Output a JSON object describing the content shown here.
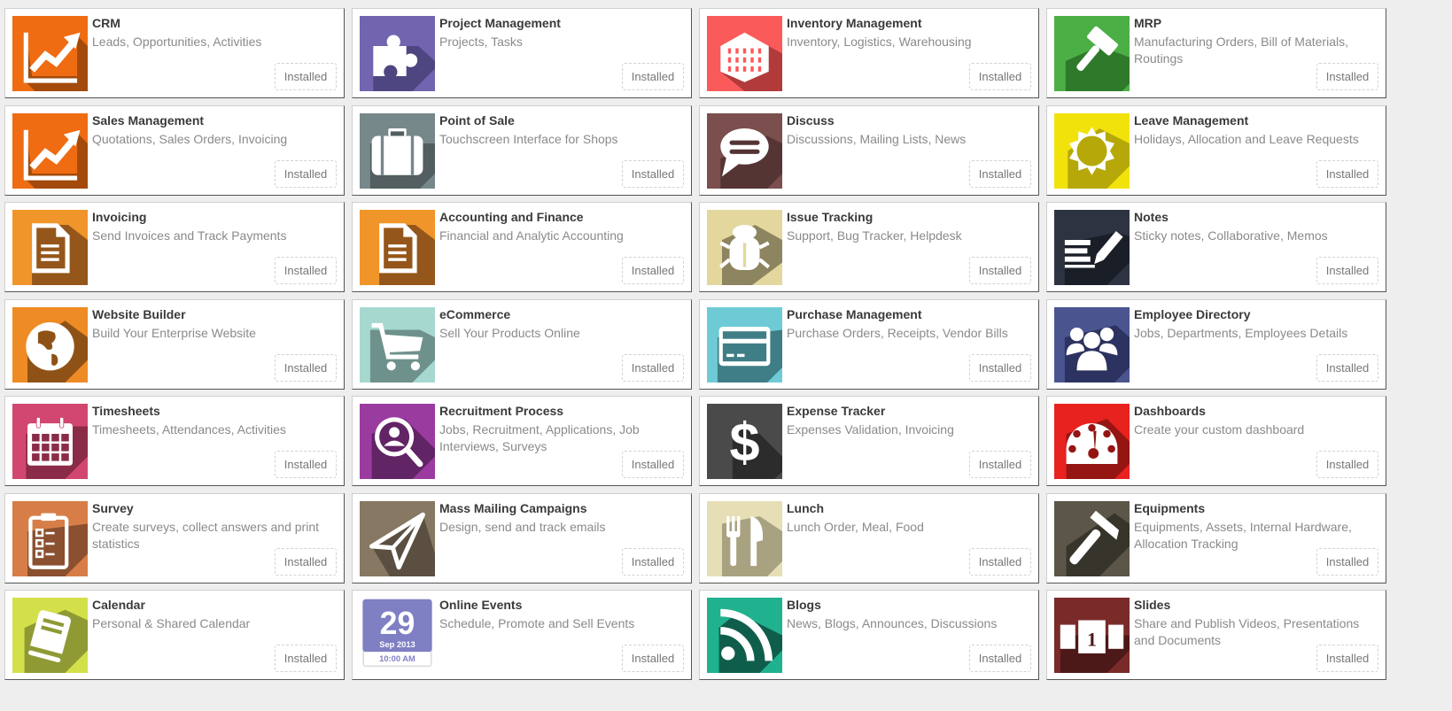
{
  "status_label": "Installed",
  "apps": [
    {
      "name": "CRM",
      "summary": "Leads, Opportunities, Activities",
      "icon": "chart-line-up-icon",
      "color": "#ef6c12",
      "shadow": "#a34a0c",
      "status": "Installed"
    },
    {
      "name": "Project Management",
      "summary": "Projects, Tasks",
      "icon": "puzzle-piece-icon",
      "color": "#7264ae",
      "shadow": "#4e4680",
      "status": "Installed"
    },
    {
      "name": "Inventory Management",
      "summary": "Inventory, Logistics, Warehousing",
      "icon": "building-icon",
      "color": "#fa5a5a",
      "shadow": "#b23a3a",
      "status": "Installed"
    },
    {
      "name": "MRP",
      "summary": "Manufacturing Orders, Bill of Materials, Routings",
      "icon": "gavel-icon",
      "color": "#4caf46",
      "shadow": "#2e7a2a",
      "status": "Installed"
    },
    {
      "name": "Sales Management",
      "summary": "Quotations, Sales Orders, Invoicing",
      "icon": "chart-line-up-icon",
      "color": "#ef6c12",
      "shadow": "#a34a0c",
      "status": "Installed"
    },
    {
      "name": "Point of Sale",
      "summary": "Touchscreen Interface for Shops",
      "icon": "briefcase-icon",
      "color": "#77888a",
      "shadow": "#525e60",
      "status": "Installed"
    },
    {
      "name": "Discuss",
      "summary": "Discussions, Mailing Lists, News",
      "icon": "speech-bubble-icon",
      "color": "#7a4f4e",
      "shadow": "#553534",
      "status": "Installed"
    },
    {
      "name": "Leave Management",
      "summary": "Holidays, Allocation and Leave Requests",
      "icon": "sun-icon",
      "color": "#f2e20c",
      "shadow": "#b5a808",
      "status": "Installed"
    },
    {
      "name": "Invoicing",
      "summary": "Send Invoices and Track Payments",
      "icon": "document-icon",
      "color": "#f0952a",
      "shadow": "#94561a",
      "status": "Installed"
    },
    {
      "name": "Accounting and Finance",
      "summary": "Financial and Analytic Accounting",
      "icon": "document-icon",
      "color": "#f0952a",
      "shadow": "#94561a",
      "status": "Installed"
    },
    {
      "name": "Issue Tracking",
      "summary": "Support, Bug Tracker, Helpdesk",
      "icon": "bug-icon",
      "color": "#e4d79e",
      "shadow": "#8d8460",
      "status": "Installed"
    },
    {
      "name": "Notes",
      "summary": "Sticky notes, Collaborative, Memos",
      "icon": "notes-pencil-icon",
      "color": "#2d3341",
      "shadow": "#1a1e27",
      "status": "Installed"
    },
    {
      "name": "Website Builder",
      "summary": "Build Your Enterprise Website",
      "icon": "globe-icon",
      "color": "#ef8b25",
      "shadow": "#8f5216",
      "status": "Installed"
    },
    {
      "name": "eCommerce",
      "summary": "Sell Your Products Online",
      "icon": "shopping-cart-icon",
      "color": "#a6d8d0",
      "shadow": "#6e918b",
      "status": "Installed"
    },
    {
      "name": "Purchase Management",
      "summary": "Purchase Orders, Receipts, Vendor Bills",
      "icon": "credit-card-icon",
      "color": "#6ecbd6",
      "shadow": "#3f7e87",
      "status": "Installed"
    },
    {
      "name": "Employee Directory",
      "summary": "Jobs, Departments, Employees Details",
      "icon": "users-icon",
      "color": "#4a5590",
      "shadow": "#2c3360",
      "status": "Installed"
    },
    {
      "name": "Timesheets",
      "summary": "Timesheets, Attendances, Activities",
      "icon": "calendar-icon",
      "color": "#d2476f",
      "shadow": "#8a2c48",
      "status": "Installed"
    },
    {
      "name": "Recruitment Process",
      "summary": "Jobs, Recruitment, Applications, Job Interviews, Surveys",
      "icon": "search-user-icon",
      "color": "#9a3ba0",
      "shadow": "#612465",
      "status": "Installed"
    },
    {
      "name": "Expense Tracker",
      "summary": "Expenses Validation, Invoicing",
      "icon": "dollar-icon",
      "color": "#4a4a4a",
      "shadow": "#2c2c2c",
      "status": "Installed"
    },
    {
      "name": "Dashboards",
      "summary": "Create your custom dashboard",
      "icon": "gauge-icon",
      "color": "#e8221f",
      "shadow": "#951513",
      "status": "Installed"
    },
    {
      "name": "Survey",
      "summary": "Create surveys, collect answers and print statistics",
      "icon": "clipboard-checklist-icon",
      "color": "#d77e48",
      "shadow": "#8a5030",
      "status": "Installed"
    },
    {
      "name": "Mass Mailing Campaigns",
      "summary": "Design, send and track emails",
      "icon": "paper-plane-icon",
      "color": "#877863",
      "shadow": "#5a4f40",
      "status": "Installed"
    },
    {
      "name": "Lunch",
      "summary": "Lunch Order, Meal, Food",
      "icon": "fork-knife-icon",
      "color": "#e6dfb6",
      "shadow": "#a9a281",
      "status": "Installed"
    },
    {
      "name": "Equipments",
      "summary": "Equipments, Assets, Internal Hardware, Allocation Tracking",
      "icon": "hammer-icon",
      "color": "#5b5647",
      "shadow": "#37342b",
      "status": "Installed"
    },
    {
      "name": "Calendar",
      "summary": "Personal & Shared Calendar",
      "icon": "agenda-book-icon",
      "color": "#d4e04a",
      "shadow": "#8f9a34",
      "status": "Installed"
    },
    {
      "name": "Online Events",
      "summary": "Schedule, Promote and Sell Events",
      "icon": "event-date-icon",
      "color": "#7f7fc4",
      "shadow": "#5c5ca0",
      "status": "Installed",
      "event_day": "29",
      "event_month": "Sep 2013",
      "event_time": "10:00 AM"
    },
    {
      "name": "Blogs",
      "summary": "News, Blogs, Announces, Discussions",
      "icon": "rss-feed-icon",
      "color": "#20b18f",
      "shadow": "#0f5e4c",
      "status": "Installed"
    },
    {
      "name": "Slides",
      "summary": "Share and Publish Videos, Presentations and Documents",
      "icon": "slides-icon",
      "color": "#7b2a2a",
      "shadow": "#4d1818",
      "status": "Installed",
      "slide_number": "1"
    }
  ]
}
